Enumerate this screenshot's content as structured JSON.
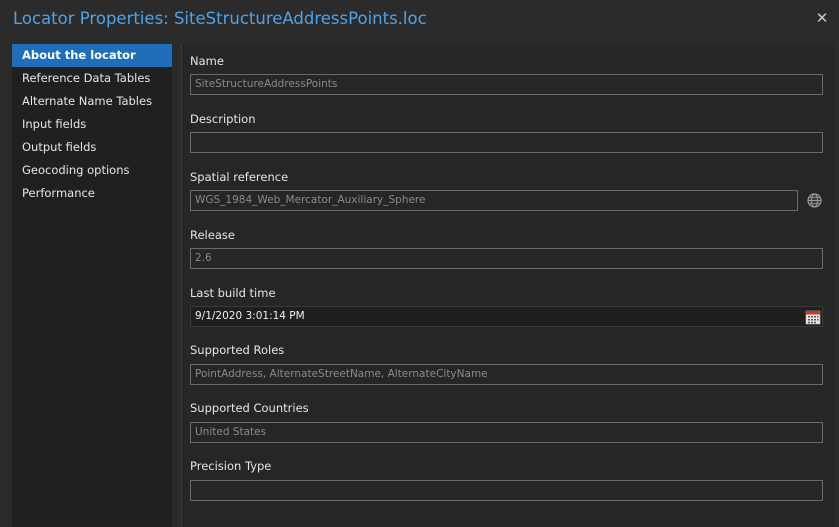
{
  "window": {
    "title": "Locator Properties: SiteStructureAddressPoints.loc",
    "close_label": "✕"
  },
  "sidebar": {
    "items": [
      {
        "label": "About the locator",
        "active": true
      },
      {
        "label": "Reference Data Tables",
        "active": false
      },
      {
        "label": "Alternate Name Tables",
        "active": false
      },
      {
        "label": "Input fields",
        "active": false
      },
      {
        "label": "Output fields",
        "active": false
      },
      {
        "label": "Geocoding options",
        "active": false
      },
      {
        "label": "Performance",
        "active": false
      }
    ]
  },
  "fields": {
    "name": {
      "label": "Name",
      "value": "SiteStructureAddressPoints"
    },
    "description": {
      "label": "Description",
      "value": ""
    },
    "spatial_reference": {
      "label": "Spatial reference",
      "value": "WGS_1984_Web_Mercator_Auxiliary_Sphere"
    },
    "release": {
      "label": "Release",
      "value": "2.6"
    },
    "last_build_time": {
      "label": "Last build time",
      "value": "9/1/2020 3:01:14 PM"
    },
    "supported_roles": {
      "label": "Supported Roles",
      "value": "PointAddress, AlternateStreetName, AlternateCityName"
    },
    "supported_countries": {
      "label": "Supported Countries",
      "value": "United States"
    },
    "precision_type": {
      "label": "Precision Type",
      "value": ""
    }
  },
  "icons": {
    "globe": "globe-icon",
    "calendar": "calendar-icon",
    "close": "close-icon"
  },
  "colors": {
    "accent": "#1e6fb8",
    "title": "#4ea3e8",
    "background": "#2b2b2b"
  }
}
